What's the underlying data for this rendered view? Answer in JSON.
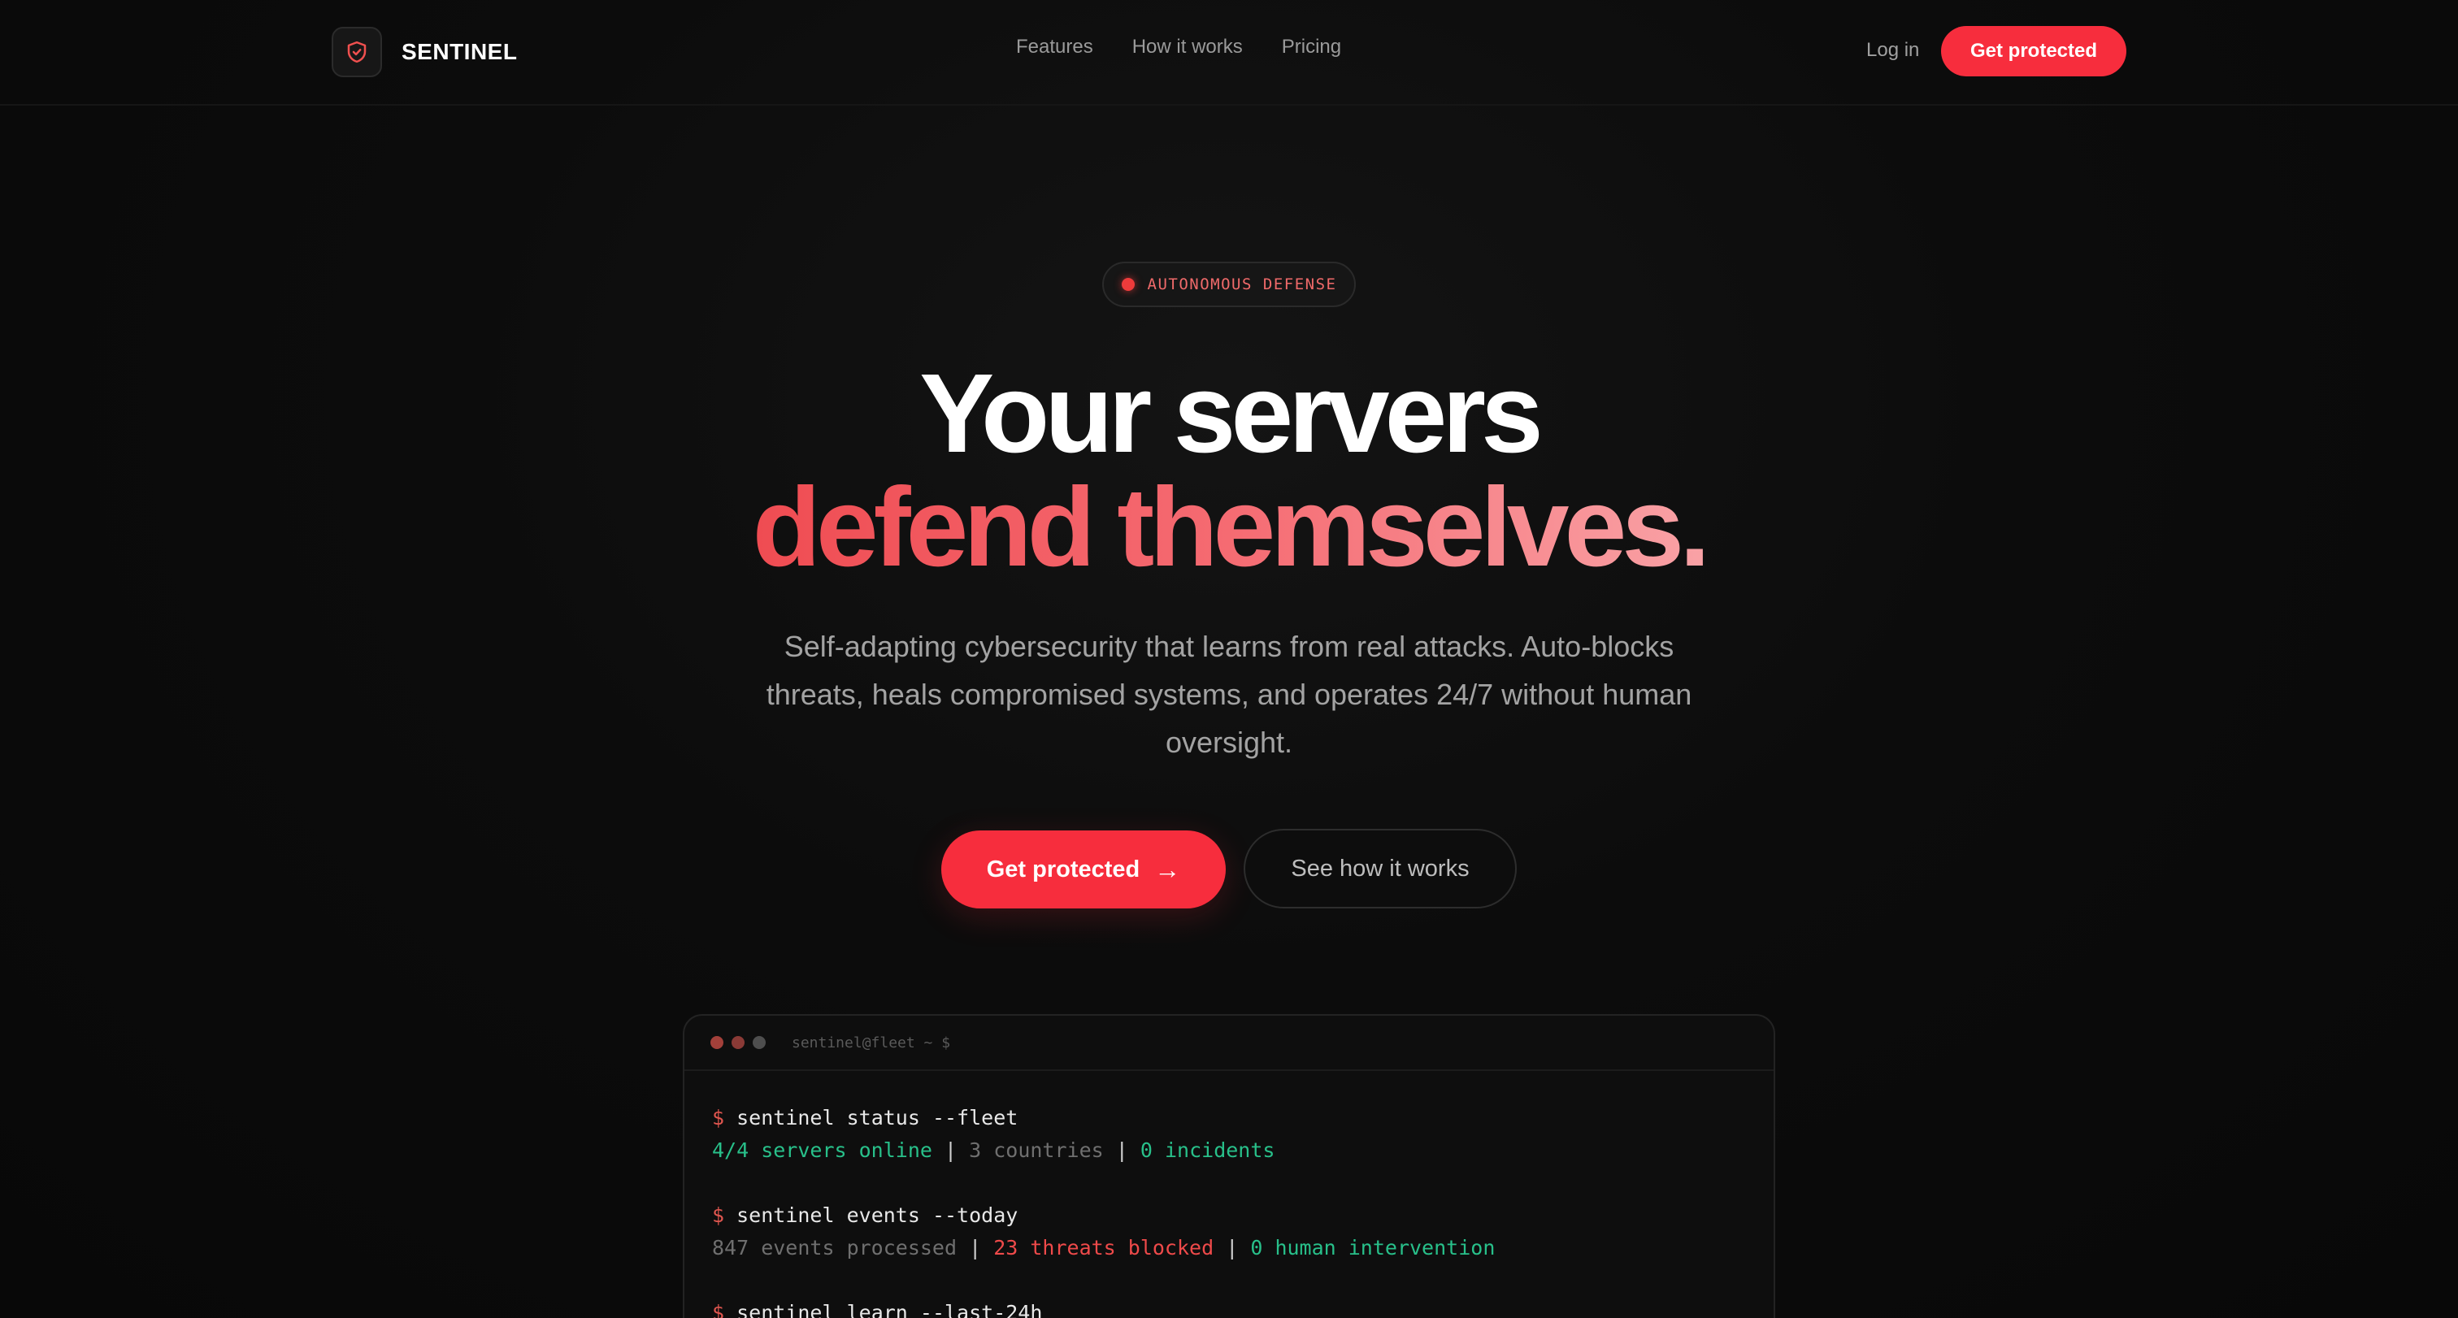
{
  "brand": {
    "name": "SENTINEL",
    "icon": "shield-check-icon"
  },
  "nav": {
    "links": [
      "Features",
      "How it works",
      "Pricing"
    ],
    "login": "Log in",
    "cta": "Get protected"
  },
  "hero": {
    "badge": "AUTONOMOUS DEFENSE",
    "headline_line1": "Your servers",
    "headline_line2": "defend themselves.",
    "subtitle": "Self-adapting cybersecurity that learns from real attacks. Auto-blocks threats, heals compromised systems, and operates 24/7 without human oversight.",
    "cta_primary": "Get protected",
    "cta_primary_icon": "arrow-right-icon",
    "cta_secondary": "See how it works"
  },
  "terminal": {
    "title": "sentinel@fleet ~ $",
    "prompt": "$",
    "commands": [
      {
        "cmd": "sentinel status --fleet",
        "output": [
          "4/4 servers online",
          "|",
          "3 countries",
          "|",
          "0 incidents"
        ]
      },
      {
        "cmd": "sentinel events --today",
        "output": [
          "847 events processed",
          "|",
          "23 threats blocked",
          "|",
          "0 human intervention"
        ]
      },
      {
        "cmd": "sentinel learn --last-24h"
      }
    ]
  },
  "colors": {
    "accent": "#f72d3d",
    "success": "#28c08a",
    "danger": "#ef4a4a",
    "background": "#0a0a0a"
  }
}
